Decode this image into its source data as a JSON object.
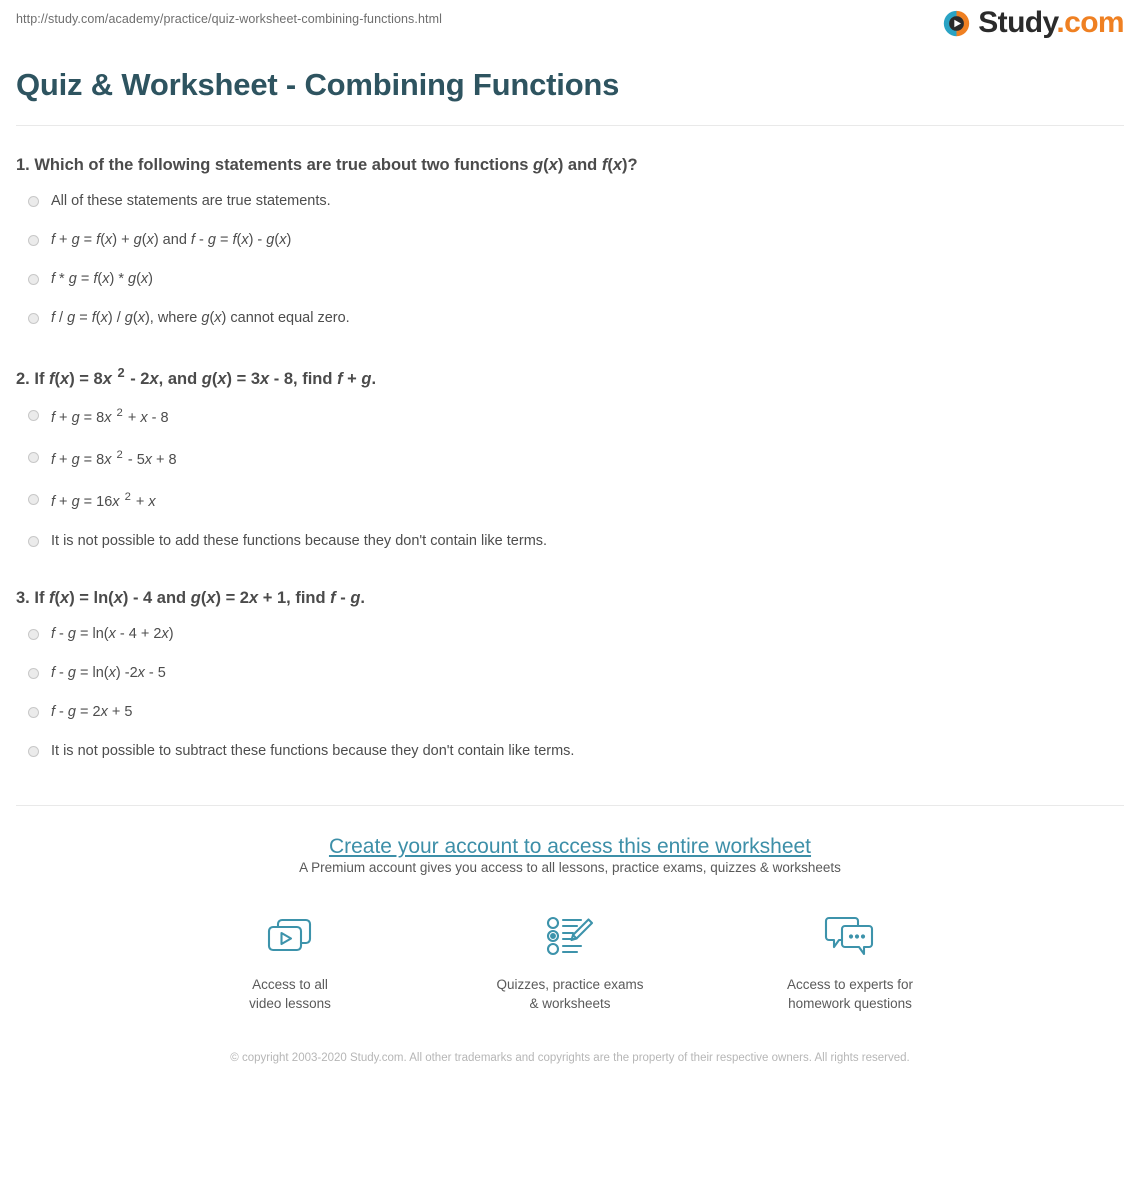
{
  "header": {
    "url": "http://study.com/academy/practice/quiz-worksheet-combining-functions.html",
    "brand_name": "Study",
    "brand_tld": ".com",
    "brand_icon": "play-circle-icon",
    "brand_colors": {
      "blue": "#2aa3c4",
      "orange": "#ef8022",
      "text": "#2b2b2b"
    }
  },
  "page_title": "Quiz & Worksheet - Combining Functions",
  "title_color": "#2e5460",
  "questions": [
    {
      "number": "1.",
      "prompt_html": "Which of the following statements are true about two functions <i class=\"v\">g</i>(<i class=\"v\">x</i>) and <i class=\"v\">f</i>(<i class=\"v\">x</i>)?",
      "prompt_text": "1. Which of the following statements are true about two functions g(x) and f(x)?",
      "options": [
        {
          "html": "All of these statements are true statements.",
          "text": "All of these statements are true statements."
        },
        {
          "html": "<i class=\"v\">f</i> + <i class=\"v\">g</i> = <i class=\"v\">f</i>(<i class=\"v\">x</i>) + <i class=\"v\">g</i>(<i class=\"v\">x</i>) and <i class=\"v\">f</i> - <i class=\"v\">g</i> = <i class=\"v\">f</i>(<i class=\"v\">x</i>) - <i class=\"v\">g</i>(<i class=\"v\">x</i>)",
          "text": "f + g = f(x) + g(x) and f - g = f(x) - g(x)"
        },
        {
          "html": "<i class=\"v\">f</i> * <i class=\"v\">g</i> = <i class=\"v\">f</i>(<i class=\"v\">x</i>) * <i class=\"v\">g</i>(<i class=\"v\">x</i>)",
          "text": "f * g = f(x) * g(x)"
        },
        {
          "html": "<i class=\"v\">f</i> / <i class=\"v\">g</i> = <i class=\"v\">f</i>(<i class=\"v\">x</i>) / <i class=\"v\">g</i>(<i class=\"v\">x</i>), where <i class=\"v\">g</i>(<i class=\"v\">x</i>) cannot equal zero.",
          "text": "f / g = f(x) / g(x), where g(x) cannot equal zero."
        }
      ]
    },
    {
      "number": "2.",
      "prompt_html": "If <i class=\"v\">f</i>(<i class=\"v\">x</i>) = 8<i class=\"v\">x</i> <sup class=\"exp\">2</sup> - 2<i class=\"v\">x</i>, and <i class=\"v\">g</i>(<i class=\"v\">x</i>) = 3<i class=\"v\">x</i> - 8, find <i class=\"v\">f</i> + <i class=\"v\">g</i>.",
      "prompt_text": "2. If f(x) = 8x 2 - 2x, and g(x) = 3x - 8, find f + g.",
      "options": [
        {
          "html": "<i class=\"v\">f</i> + <i class=\"v\">g</i> = 8<i class=\"v\">x</i> <sup class=\"exp\">2</sup> + <i class=\"v\">x</i> - 8",
          "text": "f + g = 8x 2 + x - 8"
        },
        {
          "html": "<i class=\"v\">f</i> + <i class=\"v\">g</i> = 8<i class=\"v\">x</i> <sup class=\"exp\">2</sup> - 5<i class=\"v\">x</i> + 8",
          "text": "f + g = 8x 2 - 5x + 8"
        },
        {
          "html": "<i class=\"v\">f</i> + <i class=\"v\">g</i> = 16<i class=\"v\">x</i> <sup class=\"exp\">2</sup> + <i class=\"v\">x</i>",
          "text": "f + g = 16x 2 + x"
        },
        {
          "html": "It is not possible to add these functions because they don't contain like terms.",
          "text": "It is not possible to add these functions because they don't contain like terms."
        }
      ]
    },
    {
      "number": "3.",
      "prompt_html": "If <i class=\"v\">f</i>(<i class=\"v\">x</i>) = ln(<i class=\"v\">x</i>) - 4 and <i class=\"v\">g</i>(<i class=\"v\">x</i>) = 2<i class=\"v\">x</i> + 1, find <i class=\"v\">f</i> - <i class=\"v\">g</i>.",
      "prompt_text": "3. If f(x) = ln(x) - 4 and g(x) = 2x + 1, find f - g.",
      "options": [
        {
          "html": "<i class=\"v\">f</i> - <i class=\"v\">g</i> = ln(<i class=\"v\">x</i> - 4 + 2<i class=\"v\">x</i>)",
          "text": "f - g = ln(x - 4 + 2x)"
        },
        {
          "html": "<i class=\"v\">f</i> - <i class=\"v\">g</i> = ln(<i class=\"v\">x</i>) -2<i class=\"v\">x</i> - 5",
          "text": "f - g = ln(x) -2x - 5"
        },
        {
          "html": "<i class=\"v\">f</i> - <i class=\"v\">g</i> = 2<i class=\"v\">x</i> + 5",
          "text": "f - g = 2x + 5"
        },
        {
          "html": "It is not possible to subtract these functions because they don't contain like terms.",
          "text": "It is not possible to subtract these functions because they don't contain like terms."
        }
      ]
    }
  ],
  "cta": {
    "heading": "Create your account to access this entire worksheet",
    "heading_color": "#3d8fa8",
    "subtext": "A Premium account gives you access to all lessons, practice exams, quizzes & worksheets",
    "benefits": [
      {
        "icon": "video-lessons-icon",
        "caption": "Access to all\nvideo lessons"
      },
      {
        "icon": "quiz-pencil-icon",
        "caption": "Quizzes, practice exams\n& worksheets"
      },
      {
        "icon": "chat-bubbles-icon",
        "caption": "Access to experts for\nhomework questions"
      }
    ],
    "icon_color": "#3d93ab"
  },
  "footer": {
    "copyright": "© copyright 2003-2020 Study.com. All other trademarks and copyrights are the property of their respective owners. All rights reserved."
  }
}
